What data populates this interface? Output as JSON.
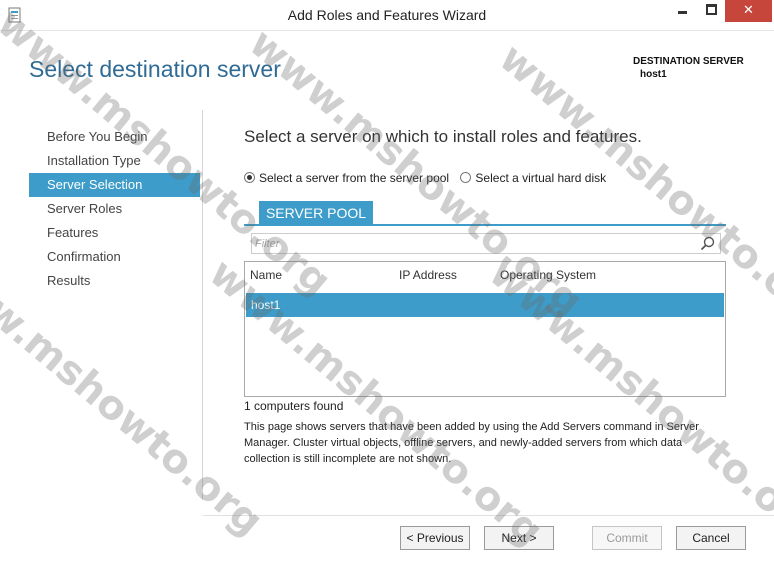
{
  "window": {
    "title": "Add Roles and Features Wizard",
    "controls": {
      "minimize": "minimize-icon",
      "maximize": "maximize-icon",
      "close": "close-icon"
    }
  },
  "header": {
    "page_title": "Select destination server",
    "destination_label": "DESTINATION SERVER",
    "destination_value": "host1"
  },
  "sidebar": {
    "items": [
      {
        "label": "Before You Begin",
        "active": false
      },
      {
        "label": "Installation Type",
        "active": false
      },
      {
        "label": "Server Selection",
        "active": true
      },
      {
        "label": "Server Roles",
        "active": false
      },
      {
        "label": "Features",
        "active": false
      },
      {
        "label": "Confirmation",
        "active": false
      },
      {
        "label": "Results",
        "active": false
      }
    ]
  },
  "main": {
    "heading": "Select a server on which to install roles and features.",
    "options": [
      {
        "label": "Select a server from the server pool",
        "selected": true
      },
      {
        "label": "Select a virtual hard disk",
        "selected": false
      }
    ],
    "pool_tab": "SERVER POOL",
    "filter_placeholder": "Filter",
    "table": {
      "columns": [
        "Name",
        "IP Address",
        "Operating System"
      ],
      "rows": [
        {
          "name": "host1",
          "ip": "",
          "os": "",
          "selected": true
        }
      ]
    },
    "count_text": "1 computers found",
    "description": "This page shows servers that have been added by using the Add Servers command in Server Manager.  Cluster virtual objects, offline servers, and newly-added servers from which data collection is still incomplete are not shown."
  },
  "footer": {
    "previous": "< Previous",
    "next": "Next >",
    "commit": "Commit",
    "cancel": "Cancel"
  },
  "watermark": "www.mshowto.org",
  "colors": {
    "accent": "#3d9cc9",
    "title_blue": "#2f6b94",
    "close_red": "#c7463c"
  }
}
